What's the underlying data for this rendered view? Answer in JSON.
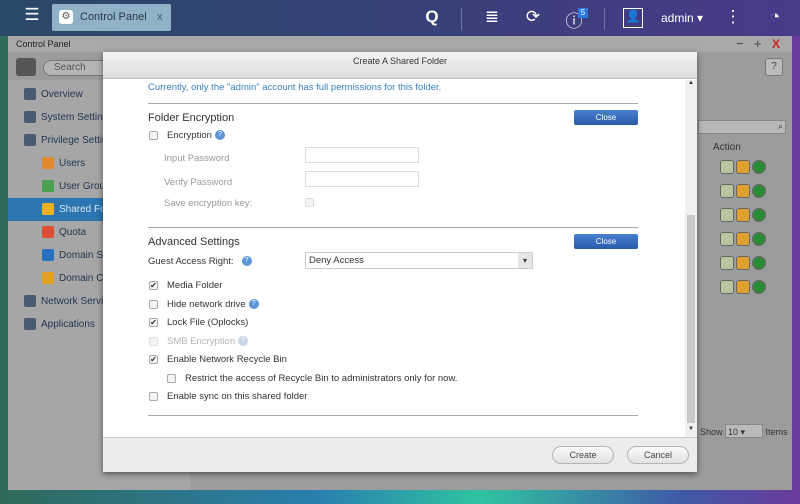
{
  "topbar": {
    "tab_label": "Control Panel",
    "tab_close": "x",
    "user": "admin",
    "notification_count": "5"
  },
  "window": {
    "title": "Control Panel",
    "search_placeholder": "Search",
    "help": "?"
  },
  "sidebar": {
    "items": [
      {
        "label": "Overview",
        "color": "#4a5a70"
      },
      {
        "label": "System Settings",
        "color": "#4a5a70"
      },
      {
        "label": "Privilege Settings",
        "color": "#4a5a70"
      },
      {
        "label": "Users",
        "color": "#e08a30"
      },
      {
        "label": "User Groups",
        "color": "#4aa050"
      },
      {
        "label": "Shared Folders",
        "color": "#f0b020"
      },
      {
        "label": "Quota",
        "color": "#e05030"
      },
      {
        "label": "Domain Security",
        "color": "#2a70c0"
      },
      {
        "label": "Domain Controller",
        "color": "#e0a020"
      },
      {
        "label": "Network Services",
        "color": "#4a5a70"
      },
      {
        "label": "Applications",
        "color": "#4a5a70"
      }
    ]
  },
  "table": {
    "action_header": "Action",
    "row_count": 6,
    "show_label": "Show",
    "page_size": "10",
    "items_label": "Items"
  },
  "dialog": {
    "title": "Create A Shared Folder",
    "notice": "Currently, only the \"admin\" account has full permissions for this folder.",
    "encryption": {
      "heading": "Folder Encryption",
      "close": "Close",
      "encryption_label": "Encryption",
      "encryption_checked": false,
      "input_password": "Input Password",
      "verify_password": "Verify Password",
      "save_key": "Save encryption key:"
    },
    "advanced": {
      "heading": "Advanced Settings",
      "close": "Close",
      "guest_label": "Guest Access Right:",
      "guest_value": "Deny Access",
      "options": [
        {
          "label": "Media Folder",
          "checked": true
        },
        {
          "label": "Hide network drive",
          "checked": false,
          "help": true
        },
        {
          "label": "Lock File (Oplocks)",
          "checked": true
        },
        {
          "label": "SMB Encryption",
          "checked": false,
          "disabled": true,
          "help": true
        },
        {
          "label": "Enable Network Recycle Bin",
          "checked": true
        },
        {
          "label": "Restrict the access of Recycle Bin to administrators only for now.",
          "checked": false,
          "indent": true
        },
        {
          "label": "Enable sync on this shared folder",
          "checked": false
        }
      ]
    },
    "create": "Create",
    "cancel": "Cancel"
  }
}
